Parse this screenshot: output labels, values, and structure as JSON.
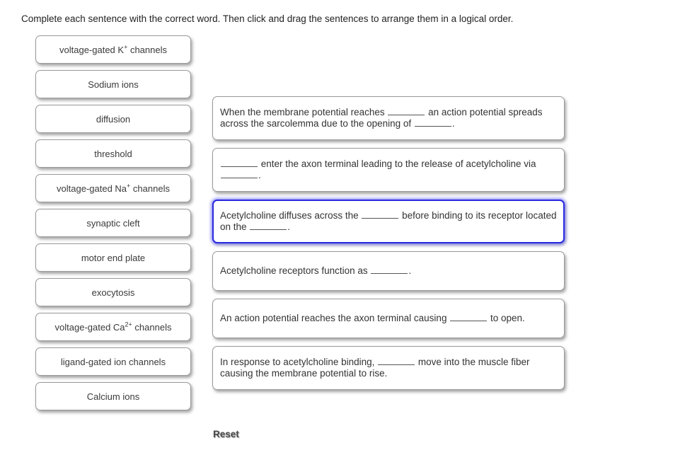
{
  "instruction": "Complete each sentence with the correct word.  Then click and drag the sentences to arrange them in a logical order.",
  "word_bank": {
    "items": [
      {
        "label": "voltage-gated K+ channels",
        "pre": "voltage-gated K",
        "sup": "+",
        "post": " channels"
      },
      {
        "label": "Sodium ions",
        "pre": "Sodium ions",
        "sup": "",
        "post": ""
      },
      {
        "label": "diffusion",
        "pre": "diffusion",
        "sup": "",
        "post": ""
      },
      {
        "label": "threshold",
        "pre": "threshold",
        "sup": "",
        "post": ""
      },
      {
        "label": "voltage-gated Na+ channels",
        "pre": "voltage-gated Na",
        "sup": "+",
        "post": " channels"
      },
      {
        "label": "synaptic cleft",
        "pre": "synaptic cleft",
        "sup": "",
        "post": ""
      },
      {
        "label": "motor end plate",
        "pre": "motor end plate",
        "sup": "",
        "post": ""
      },
      {
        "label": "exocytosis",
        "pre": "exocytosis",
        "sup": "",
        "post": ""
      },
      {
        "label": "voltage-gated Ca2+ channels",
        "pre": "voltage-gated Ca",
        "sup": "2+",
        "post": " channels"
      },
      {
        "label": "ligand-gated ion channels",
        "pre": "ligand-gated ion channels",
        "sup": "",
        "post": ""
      },
      {
        "label": "Calcium ions",
        "pre": "Calcium ions",
        "sup": "",
        "post": ""
      }
    ]
  },
  "sentences": {
    "items": [
      {
        "text": "When the membrane potential reaches ________ an action potential spreads across the sarcolemma due to the opening of ________.",
        "segments": [
          "When the membrane potential reaches ",
          "BLANK",
          " an action potential spreads across the sarcolemma due to the opening of ",
          "BLANK",
          "."
        ],
        "selected": false
      },
      {
        "text": "________ enter the axon terminal leading to the release of acetylcholine via ________.",
        "segments": [
          "",
          "BLANK",
          " enter the axon terminal leading to the release of acetylcholine via ",
          "BLANK",
          "."
        ],
        "selected": false
      },
      {
        "text": "Acetylcholine diffuses across the ________ before binding to its receptor located on the ________.",
        "segments": [
          "Acetylcholine diffuses across the ",
          "BLANK",
          " before binding to its receptor located on the ",
          "BLANK",
          "."
        ],
        "selected": true
      },
      {
        "text": "Acetylcholine receptors function as ________.",
        "segments": [
          "Acetylcholine receptors function as ",
          "BLANK",
          "."
        ],
        "selected": false
      },
      {
        "text": "An action potential reaches the axon terminal causing ________ to open.",
        "segments": [
          "An action potential reaches the axon terminal causing ",
          "BLANK",
          " to open."
        ],
        "selected": false
      },
      {
        "text": "In response to acetylcholine binding, ________ move into the muscle fiber causing the membrane potential to rise.",
        "segments": [
          "In response to acetylcholine binding, ",
          "BLANK",
          " move into the muscle fiber causing the membrane potential to rise."
        ],
        "selected": false
      }
    ]
  },
  "reset": {
    "label": "Reset"
  },
  "colors": {
    "selection_border": "#2a2adf",
    "chip_border": "#9a9a9a",
    "text": "#333333",
    "background": "#ffffff"
  }
}
